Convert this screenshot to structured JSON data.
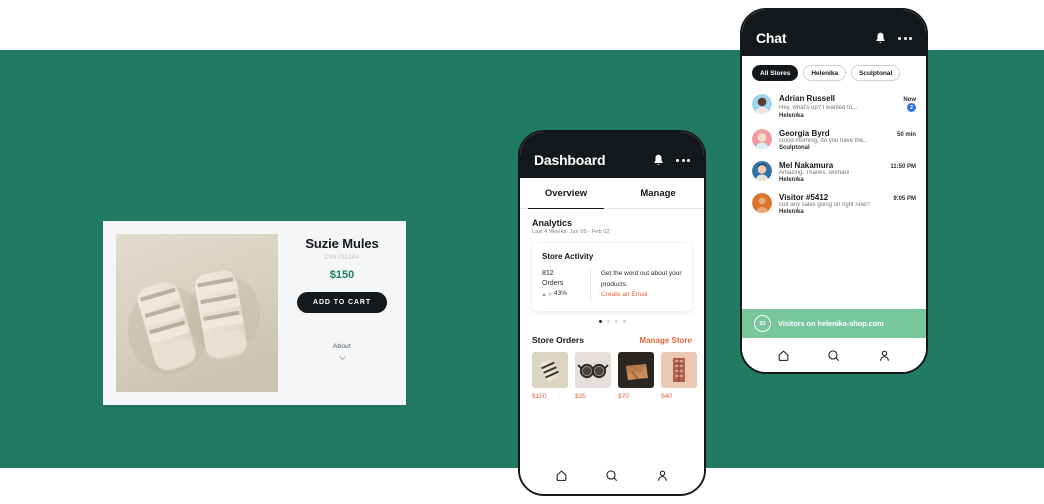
{
  "background": {
    "band_color": "#217a62",
    "page_color": "#ffffff"
  },
  "product_card": {
    "name": "product-card",
    "title": "Suzie Mules",
    "sku": "C46700104",
    "price": "$150",
    "price_color": "#217a62",
    "add_to_cart_label": "ADD TO CART",
    "about_label": "About",
    "about_icon": "chevron-down-icon",
    "image_alt": "tan strappy mule sandals"
  },
  "dashboard_phone": {
    "header": {
      "title": "Dashboard",
      "bell_icon": "bell-icon",
      "more_icon": "more-dots-icon"
    },
    "tabs": [
      {
        "label": "Overview",
        "active": true
      },
      {
        "label": "Manage",
        "active": false
      }
    ],
    "analytics": {
      "title": "Analytics",
      "subtitle": "Last 4 Weeks: Jan 05 - Feb 02"
    },
    "store_activity": {
      "title": "Store Activity",
      "orders_count": "812",
      "orders_label": "Orders",
      "delta": "43%",
      "delta_up_icon": "triangle-up-icon",
      "delta_down_icon": "triangle-down-icon",
      "promo_text": "Get the word out about your products.",
      "promo_link": "Create an Email",
      "promo_link_color": "#e2683c"
    },
    "carousel": {
      "total": 4,
      "active_index": 0
    },
    "store_orders": {
      "title": "Store Orders",
      "link": "Manage Store",
      "link_color": "#e2683c",
      "items": [
        {
          "price": "$150",
          "alt": "striped sandals"
        },
        {
          "price": "$35",
          "alt": "round sunglasses"
        },
        {
          "price": "$70",
          "alt": "leather clutch bag"
        },
        {
          "price": "$40",
          "alt": "patterned textile"
        }
      ]
    },
    "bottom_nav": [
      {
        "icon": "home-icon",
        "label": "Home"
      },
      {
        "icon": "search-icon",
        "label": "Search"
      },
      {
        "icon": "profile-icon",
        "label": "Profile"
      }
    ]
  },
  "chat_phone": {
    "header": {
      "title": "Chat",
      "bell_icon": "bell-icon",
      "more_icon": "more-dots-icon"
    },
    "filters": [
      {
        "label": "All Stores",
        "active": true
      },
      {
        "label": "Helenika",
        "active": false
      },
      {
        "label": "Sculptonal",
        "active": false
      }
    ],
    "conversations": [
      {
        "name": "Adrian Russell",
        "time": "Now",
        "snippet": "Hey, what's up? I wanted to...",
        "store": "Helenika",
        "unread": "2",
        "avatar": "adrian-avatar"
      },
      {
        "name": "Georgia Byrd",
        "time": "50 min",
        "snippet": "Good morning, do you have the...",
        "store": "Sculptonal",
        "unread": "",
        "avatar": "georgia-avatar"
      },
      {
        "name": "Mel Nakamura",
        "time": "11:50 PM",
        "snippet": "Amazing. Thanks, woman!",
        "store": "Helenika",
        "unread": "",
        "avatar": "mel-avatar"
      },
      {
        "name": "Visitor #5412",
        "time": "9:05 PM",
        "snippet": "Got any sales going on right now?",
        "store": "Helenika",
        "unread": "",
        "avatar": "visitor-avatar"
      }
    ],
    "visitors_bar": {
      "count": "93",
      "text": "Visitors on helenika-shop.com",
      "color": "#77c69c"
    },
    "bottom_nav": [
      {
        "icon": "home-icon",
        "label": "Home"
      },
      {
        "icon": "search-icon",
        "label": "Search"
      },
      {
        "icon": "profile-icon",
        "label": "Profile"
      }
    ]
  }
}
